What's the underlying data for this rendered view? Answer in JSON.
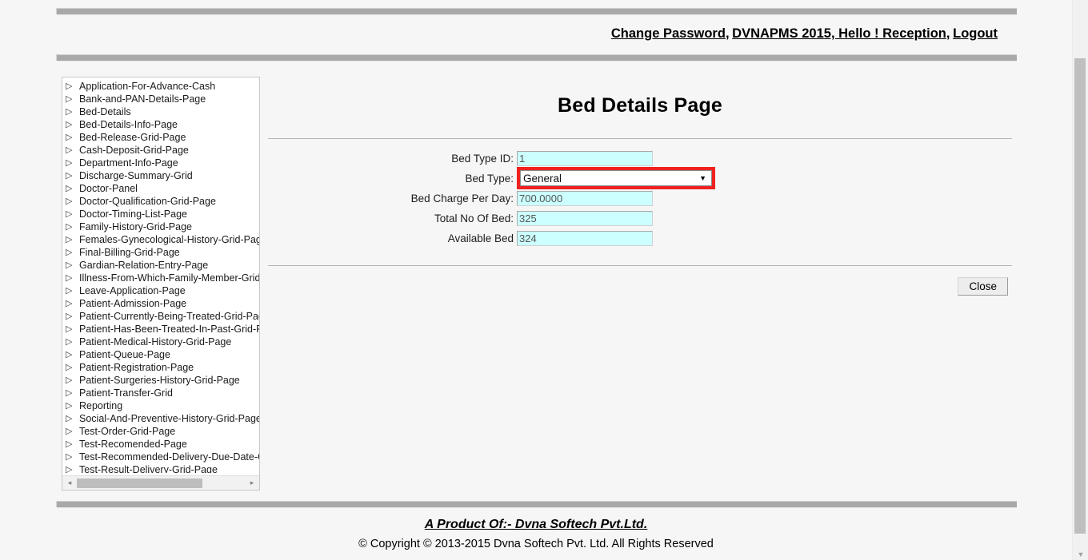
{
  "header": {
    "links": [
      {
        "label": "Change Password",
        "sep": ","
      },
      {
        "label": "DVNAPMS 2015, Hello ! Reception",
        "sep": ","
      },
      {
        "label": "Logout",
        "sep": ""
      }
    ]
  },
  "sidebar": {
    "items": [
      {
        "label": "Application-For-Advance-Cash",
        "icon": "expander-triangle-icon"
      },
      {
        "label": "Bank-and-PAN-Details-Page",
        "icon": "expander-triangle-icon"
      },
      {
        "label": "Bed-Details",
        "icon": "expander-triangle-icon"
      },
      {
        "label": "Bed-Details-Info-Page",
        "icon": "expander-triangle-icon"
      },
      {
        "label": "Bed-Release-Grid-Page",
        "icon": "expander-triangle-icon"
      },
      {
        "label": "Cash-Deposit-Grid-Page",
        "icon": "expander-triangle-icon"
      },
      {
        "label": "Department-Info-Page",
        "icon": "expander-triangle-icon"
      },
      {
        "label": "Discharge-Summary-Grid",
        "icon": "expander-triangle-icon"
      },
      {
        "label": "Doctor-Panel",
        "icon": "expander-triangle-icon"
      },
      {
        "label": "Doctor-Qualification-Grid-Page",
        "icon": "expander-triangle-icon"
      },
      {
        "label": "Doctor-Timing-List-Page",
        "icon": "expander-triangle-icon"
      },
      {
        "label": "Family-History-Grid-Page",
        "icon": "expander-triangle-icon"
      },
      {
        "label": "Females-Gynecological-History-Grid-Page",
        "icon": "expander-triangle-icon"
      },
      {
        "label": "Final-Billing-Grid-Page",
        "icon": "expander-triangle-icon"
      },
      {
        "label": "Gardian-Relation-Entry-Page",
        "icon": "expander-triangle-icon"
      },
      {
        "label": "Illness-From-Which-Family-Member-Grid",
        "icon": "expander-triangle-icon"
      },
      {
        "label": "Leave-Application-Page",
        "icon": "expander-triangle-icon"
      },
      {
        "label": "Patient-Admission-Page",
        "icon": "expander-triangle-icon"
      },
      {
        "label": "Patient-Currently-Being-Treated-Grid-Page",
        "icon": "expander-triangle-icon"
      },
      {
        "label": "Patient-Has-Been-Treated-In-Past-Grid-Page",
        "icon": "expander-triangle-icon"
      },
      {
        "label": "Patient-Medical-History-Grid-Page",
        "icon": "expander-triangle-icon"
      },
      {
        "label": "Patient-Queue-Page",
        "icon": "expander-triangle-icon"
      },
      {
        "label": "Patient-Registration-Page",
        "icon": "expander-triangle-icon"
      },
      {
        "label": "Patient-Surgeries-History-Grid-Page",
        "icon": "expander-triangle-icon"
      },
      {
        "label": "Patient-Transfer-Grid",
        "icon": "expander-triangle-icon"
      },
      {
        "label": "Reporting",
        "icon": "expander-triangle-icon"
      },
      {
        "label": "Social-And-Preventive-History-Grid-Page",
        "icon": "expander-triangle-icon"
      },
      {
        "label": "Test-Order-Grid-Page",
        "icon": "expander-triangle-icon"
      },
      {
        "label": "Test-Recomended-Page",
        "icon": "expander-triangle-icon"
      },
      {
        "label": "Test-Recommended-Delivery-Due-Date-Grid-Page",
        "icon": "expander-triangle-icon"
      },
      {
        "label": "Test-Result-Delivery-Grid-Page",
        "icon": "expander-triangle-icon"
      }
    ],
    "scrollbar": {
      "left_arrow": "◂",
      "right_arrow": "▸"
    }
  },
  "main": {
    "title": "Bed Details Page",
    "fields": [
      {
        "label": "Bed Type ID:",
        "value": "1",
        "type": "text"
      },
      {
        "label": "Bed Type:",
        "value": "General",
        "type": "select"
      },
      {
        "label": "Bed Charge Per Day:",
        "value": "700.0000",
        "type": "text"
      },
      {
        "label": "Total No Of Bed:",
        "value": "325",
        "type": "text"
      },
      {
        "label": "Available Bed",
        "value": "324",
        "type": "text"
      }
    ],
    "bed_type_options": [
      "General"
    ],
    "close_label": "Close"
  },
  "footer": {
    "product": "A Product Of:- Dvna Softech Pvt.Ltd.",
    "copyright": "© Copyright © 2013-2015 Dvna Softech Pvt. Ltd. All Rights Reserved"
  },
  "icons": {
    "caret_down": "▼",
    "expander": "▷",
    "scroll_down_arrow": "▼"
  },
  "colors": {
    "highlight": "#f02020",
    "input_bg": "#ccffff",
    "divider": "#a9a9a9"
  }
}
